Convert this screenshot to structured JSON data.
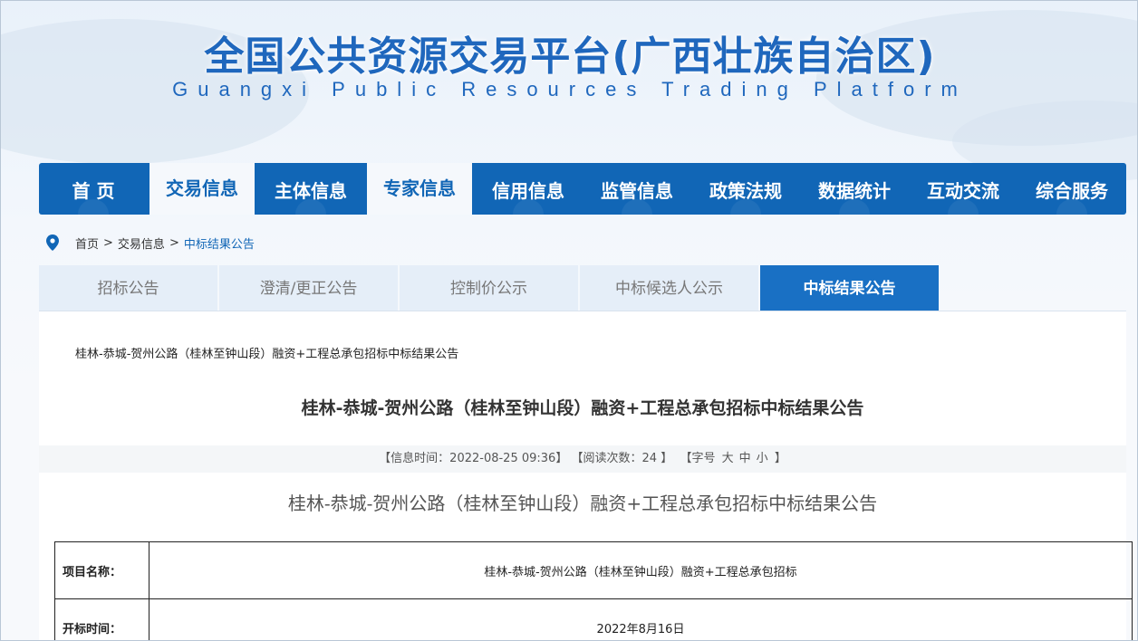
{
  "header": {
    "title": "全国公共资源交易平台(广西壮族自治区)",
    "subtitle": "Guangxi Public Resources Trading Platform"
  },
  "nav": [
    {
      "label": "首 页",
      "active": false
    },
    {
      "label": "交易信息",
      "active": true
    },
    {
      "label": "主体信息",
      "active": false
    },
    {
      "label": "专家信息",
      "active": true
    },
    {
      "label": "信用信息",
      "active": false
    },
    {
      "label": "监管信息",
      "active": false
    },
    {
      "label": "政策法规",
      "active": false
    },
    {
      "label": "数据统计",
      "active": false
    },
    {
      "label": "互动交流",
      "active": false
    },
    {
      "label": "综合服务",
      "active": false
    }
  ],
  "breadcrumb": {
    "icon": "location-pin-icon",
    "home": "首页",
    "level1": "交易信息",
    "current": "中标结果公告",
    "separator": ">"
  },
  "tabs": [
    {
      "label": "招标公告",
      "active": false
    },
    {
      "label": "澄清/更正公告",
      "active": false
    },
    {
      "label": "控制价公示",
      "active": false
    },
    {
      "label": "中标候选人公示",
      "active": false
    },
    {
      "label": "中标结果公告",
      "active": true
    }
  ],
  "article": {
    "link_title": "桂林-恭城-贺州公路（桂林至钟山段）融资+工程总承包招标中标结果公告",
    "title": "桂林-恭城-贺州公路（桂林至钟山段）融资+工程总承包招标中标结果公告",
    "meta": {
      "time_label": "【信息时间：",
      "time_value": "2022-08-25 09:36",
      "time_end": "】",
      "views_label": "【阅读次数：",
      "views_value": "24",
      "views_end": "】",
      "font_label": "【字号",
      "font_large": "大",
      "font_medium": "中",
      "font_small": "小",
      "font_end": "】"
    },
    "doc_heading": "桂林-恭城-贺州公路（桂林至钟山段）融资+工程总承包招标中标结果公告",
    "table": [
      {
        "key": "项目名称：",
        "value": "桂林-恭城-贺州公路（桂林至钟山段）融资+工程总承包招标"
      },
      {
        "key": "开标时间：",
        "value": "2022年8月16日"
      }
    ]
  },
  "colors": {
    "brand_blue": "#1166b6",
    "tab_active": "#1970c4",
    "tab_inactive": "#e5eef8"
  }
}
